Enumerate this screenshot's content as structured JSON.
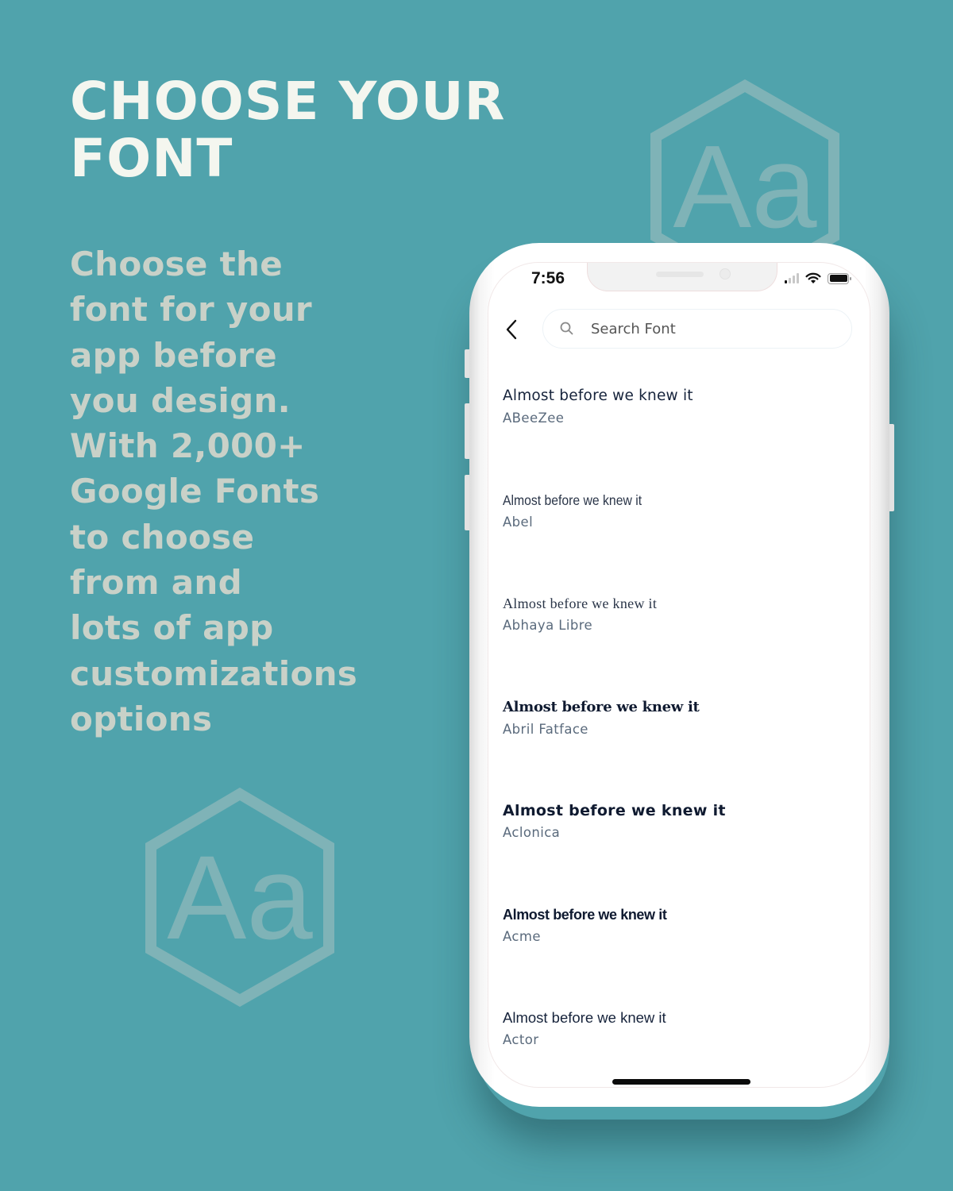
{
  "colors": {
    "background": "#50a3ac",
    "headline": "#f4f6ef",
    "blurb": "#c9d1c8",
    "sample_text": "#16233b",
    "font_name_text": "#5a6a7c"
  },
  "promo": {
    "headline_lines": [
      "CHOOSE YOUR",
      "FONT"
    ],
    "blurb_lines": [
      "Choose the",
      "font for your",
      "app before",
      "you design.",
      "With 2,000+",
      "Google Fonts",
      "to choose",
      "from and",
      "lots of app",
      "customizations",
      "options"
    ],
    "decor_icon": "aa-hexagon-icon",
    "decor_text": "Aa"
  },
  "phone": {
    "status_bar": {
      "time": "7:56",
      "icons": [
        "cellular-signal-icon",
        "wifi-icon",
        "battery-icon"
      ]
    },
    "header": {
      "back_icon": "chevron-left-icon",
      "search": {
        "icon": "search-icon",
        "placeholder": "Search Font",
        "value": ""
      }
    },
    "font_list": [
      {
        "sample": "Almost before we knew it",
        "name": "ABeeZee"
      },
      {
        "sample": "Almost before we knew it",
        "name": "Abel"
      },
      {
        "sample": "Almost before we knew it",
        "name": "Abhaya Libre"
      },
      {
        "sample": "Almost before we knew it",
        "name": "Abril Fatface"
      },
      {
        "sample": "Almost before we knew it",
        "name": "Aclonica"
      },
      {
        "sample": "Almost before we knew it",
        "name": "Acme"
      },
      {
        "sample": "Almost before we knew it",
        "name": "Actor"
      }
    ]
  }
}
